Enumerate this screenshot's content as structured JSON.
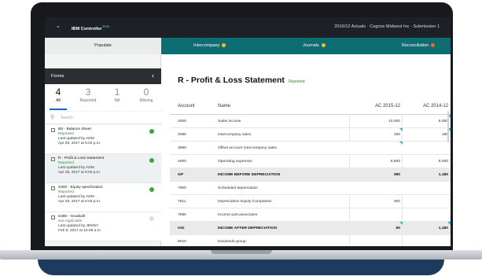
{
  "topbar": {
    "menu_icon": "chevron-down-icon",
    "app_name": "IBM Controller",
    "app_badge": "Beta",
    "context": "2016/12 Actuals · Cognos Midwest Inc · Submission 1"
  },
  "tabs": [
    {
      "label": "Populate",
      "status": null
    },
    {
      "label": "Intercompany",
      "status": "#f2c11b"
    },
    {
      "label": "Journals",
      "status": "#f2c11b"
    },
    {
      "label": "Reconciliation",
      "status": "#f06a1d"
    }
  ],
  "sidebar": {
    "title": "Forms",
    "back_icon": "chevron-left-icon",
    "stats": [
      {
        "count": "4",
        "label": "All"
      },
      {
        "count": "3",
        "label": "Reported"
      },
      {
        "count": "1",
        "label": "NA"
      },
      {
        "count": "0",
        "label": "Missing"
      }
    ],
    "search_placeholder": "Search",
    "forms": [
      {
        "title": "BS - Balance Sheet",
        "status": "Reported",
        "updated_by": "Last updated by ADM",
        "updated_at": "Apr 28, 2017 at 5:03 p.m."
      },
      {
        "title": "R - Profit & Loss Statement",
        "status": "Reported",
        "updated_by": "Last updated by ADM",
        "updated_at": "Apr 28, 2017 at 5:03 p.m."
      },
      {
        "title": "S300 - Equity specification",
        "status": "Reported",
        "updated_by": "Last updated by ADM",
        "updated_at": "Apr 28, 2017 at 5:03 p.m."
      },
      {
        "title": "S380 - Goodwill",
        "status": "Not Applicable",
        "updated_by": "Last updated by JENNY",
        "updated_at": "Feb 8, 2017 at 10:08 a.m."
      }
    ]
  },
  "main": {
    "title": "R - Profit & Loss Statement",
    "status": "Reported",
    "columns": {
      "account": "Account",
      "name": "Name",
      "ac2015": "AC 2015-12",
      "ac2014": "AC 2014-12"
    },
    "rows": [
      {
        "account": "3000",
        "name": "Sales income",
        "ac2015": "10,000",
        "ac2014": "8,000"
      },
      {
        "account": "3080",
        "name": "Intercompany sales",
        "ac2015": "190",
        "ac2014": "180"
      },
      {
        "account": "3990",
        "name": "Offset account intercompany sales",
        "ac2015": "",
        "ac2014": ""
      },
      {
        "account": "4000",
        "name": "Operating expenses",
        "ac2015": "9,800",
        "ac2014": "8,000"
      },
      {
        "account": "GP",
        "name": "INCOME BEFORE DEPRECIATION",
        "ac2015": "390",
        "ac2014": "1,180"
      },
      {
        "account": "7800",
        "name": "Scheduled depreciation",
        "ac2015": "",
        "ac2014": ""
      },
      {
        "account": "7811",
        "name": "Depreciation Equity Companies",
        "ac2015": "300",
        "ac2014": ""
      },
      {
        "account": "7890",
        "name": "Income part.associates",
        "ac2015": "",
        "ac2014": ""
      },
      {
        "account": "IAD",
        "name": "INCOME AFTER DEPRECIATION",
        "ac2015": "90",
        "ac2014": "1,180"
      },
      {
        "account": "8010",
        "name": "Dividends-group",
        "ac2015": "",
        "ac2014": ""
      }
    ]
  }
}
